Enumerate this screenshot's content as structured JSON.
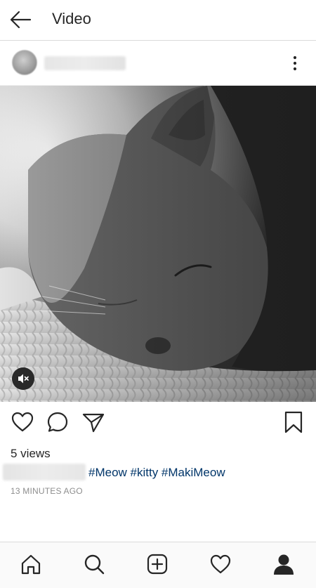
{
  "header": {
    "title": "Video",
    "back_icon": "arrow-left-icon"
  },
  "post": {
    "more_icon": "more-vertical-icon",
    "media_icon": "volume-off-icon",
    "actions": {
      "like_icon": "heart-icon",
      "comment_icon": "comment-icon",
      "share_icon": "paper-plane-icon",
      "save_icon": "bookmark-icon"
    },
    "views": "5 views",
    "hashtags": "#Meow #kitty #MakiMeow",
    "timestamp": "13 MINUTES AGO"
  },
  "bottom_nav": [
    {
      "name": "home",
      "icon": "home-icon"
    },
    {
      "name": "search",
      "icon": "search-icon"
    },
    {
      "name": "new-post",
      "icon": "add-post-icon"
    },
    {
      "name": "activity",
      "icon": "heart-icon"
    },
    {
      "name": "profile",
      "icon": "profile-icon"
    }
  ],
  "colors": {
    "text": "#262626",
    "hashtag": "#003569",
    "muted": "#8e8e8e",
    "divider": "#dbdbdb"
  }
}
